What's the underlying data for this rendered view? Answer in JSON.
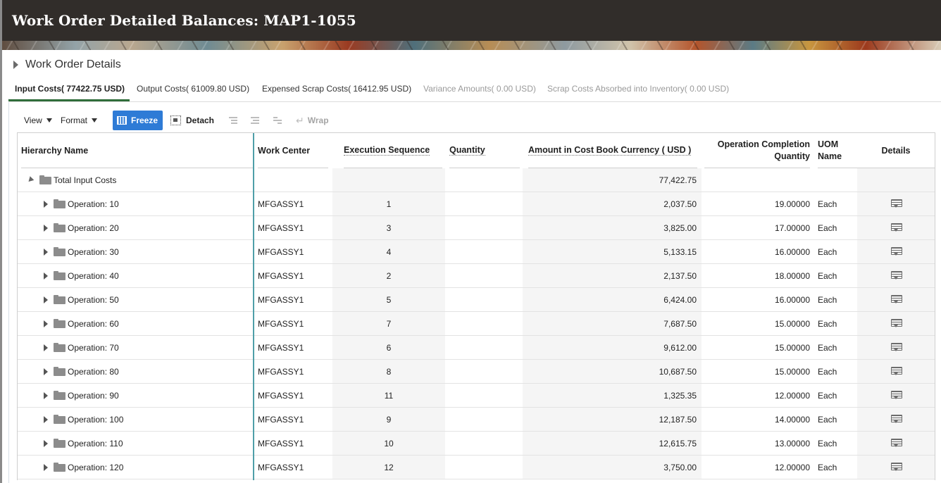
{
  "header": {
    "title": "Work Order Detailed Balances: MAP1-1055"
  },
  "section": {
    "title": "Work Order Details"
  },
  "tabs": [
    {
      "label": "Input Costs( 77422.75 USD)"
    },
    {
      "label": "Output Costs( 61009.80 USD)"
    },
    {
      "label": "Expensed Scrap Costs( 16412.95 USD)"
    },
    {
      "label": "Variance Amounts( 0.00 USD)"
    },
    {
      "label": "Scrap Costs Absorbed into Inventory( 0.00 USD)"
    }
  ],
  "toolbar": {
    "view": "View",
    "format": "Format",
    "freeze": "Freeze",
    "detach": "Detach",
    "wrap": "Wrap"
  },
  "table": {
    "headers": {
      "hierarchy": "Hierarchy Name",
      "work_center": "Work Center",
      "exec_seq": "Execution Sequence",
      "quantity": "Quantity",
      "amount": "Amount in Cost Book Currency ( USD )",
      "op_comp_1": "Operation Completion",
      "op_comp_2": "Quantity",
      "uom_1": "UOM",
      "uom_2": "Name",
      "details": "Details"
    },
    "total": {
      "name": "Total Input Costs",
      "amount": "77,422.75"
    },
    "rows": [
      {
        "name": "Operation: 10",
        "wc": "MFGASSY1",
        "seq": "1",
        "amount": "2,037.50",
        "qty": "19.00000",
        "uom": "Each"
      },
      {
        "name": "Operation: 20",
        "wc": "MFGASSY1",
        "seq": "3",
        "amount": "3,825.00",
        "qty": "17.00000",
        "uom": "Each"
      },
      {
        "name": "Operation: 30",
        "wc": "MFGASSY1",
        "seq": "4",
        "amount": "5,133.15",
        "qty": "16.00000",
        "uom": "Each"
      },
      {
        "name": "Operation: 40",
        "wc": "MFGASSY1",
        "seq": "2",
        "amount": "2,137.50",
        "qty": "18.00000",
        "uom": "Each"
      },
      {
        "name": "Operation: 50",
        "wc": "MFGASSY1",
        "seq": "5",
        "amount": "6,424.00",
        "qty": "16.00000",
        "uom": "Each"
      },
      {
        "name": "Operation: 60",
        "wc": "MFGASSY1",
        "seq": "7",
        "amount": "7,687.50",
        "qty": "15.00000",
        "uom": "Each"
      },
      {
        "name": "Operation: 70",
        "wc": "MFGASSY1",
        "seq": "6",
        "amount": "9,612.00",
        "qty": "15.00000",
        "uom": "Each"
      },
      {
        "name": "Operation: 80",
        "wc": "MFGASSY1",
        "seq": "8",
        "amount": "10,687.50",
        "qty": "15.00000",
        "uom": "Each"
      },
      {
        "name": "Operation: 90",
        "wc": "MFGASSY1",
        "seq": "11",
        "amount": "1,325.35",
        "qty": "12.00000",
        "uom": "Each"
      },
      {
        "name": "Operation: 100",
        "wc": "MFGASSY1",
        "seq": "9",
        "amount": "12,187.50",
        "qty": "14.00000",
        "uom": "Each"
      },
      {
        "name": "Operation: 110",
        "wc": "MFGASSY1",
        "seq": "10",
        "amount": "12,615.75",
        "qty": "13.00000",
        "uom": "Each"
      },
      {
        "name": "Operation: 120",
        "wc": "MFGASSY1",
        "seq": "12",
        "amount": "3,750.00",
        "qty": "12.00000",
        "uom": "Each"
      }
    ]
  }
}
